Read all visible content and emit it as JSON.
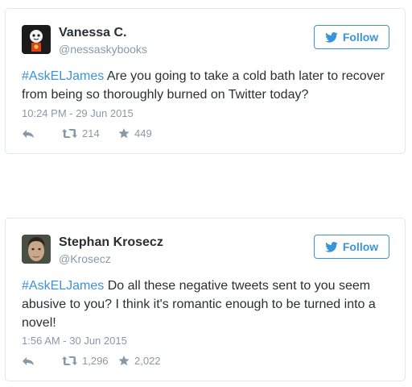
{
  "colors": {
    "brand_blue": "#3b94d9",
    "text": "#292f33",
    "muted": "#8899a6",
    "border": "#e1e8ed"
  },
  "tweets": [
    {
      "display_name": "Vanessa C.",
      "handle": "@nessaskybooks",
      "follow_label": "Follow",
      "hashtag": "#AskELJames",
      "text": " Are you going to take a cold bath later to recover from being so thoroughly burned on Twitter today?",
      "timestamp": "10:24 PM - 29 Jun 2015",
      "retweets": "214",
      "favorites": "449"
    },
    {
      "display_name": "Stephan Krosecz",
      "handle": "@Krosecz",
      "follow_label": "Follow",
      "hashtag": "#AskELJames",
      "text": " Do all these negative tweets sent to you seem abusive to you? I think it's romantic enough to be turned into a novel!",
      "timestamp": "1:56 AM - 30 Jun 2015",
      "retweets": "1,296",
      "favorites": "2,022"
    }
  ],
  "icons": {
    "follow": "twitter-bird-icon",
    "reply": "reply-arrow-icon",
    "retweet": "retweet-icon",
    "favorite": "star-icon"
  }
}
